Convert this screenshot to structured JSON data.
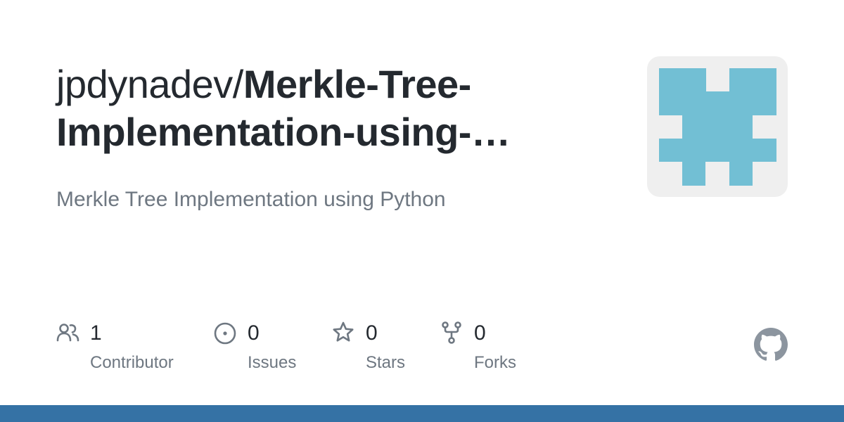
{
  "repo": {
    "owner": "jpdynadev/",
    "name": "Merkle-Tree-Implementation-using-…",
    "description": "Merkle Tree Implementation using Python"
  },
  "stats": {
    "contributors": {
      "count": "1",
      "label": "Contributor",
      "icon": "people-icon"
    },
    "issues": {
      "count": "0",
      "label": "Issues",
      "icon": "issue-opened-icon"
    },
    "stars": {
      "count": "0",
      "label": "Stars",
      "icon": "star-icon"
    },
    "forks": {
      "count": "0",
      "label": "Forks",
      "icon": "repo-forked-icon"
    }
  },
  "colors": {
    "text": "#24292f",
    "muted": "#6e7781",
    "avatar_bg": "#efefef",
    "avatar_fg": "#72bfd4",
    "bottom_bar": "#3572a5",
    "github_logo": "#8c959f"
  }
}
